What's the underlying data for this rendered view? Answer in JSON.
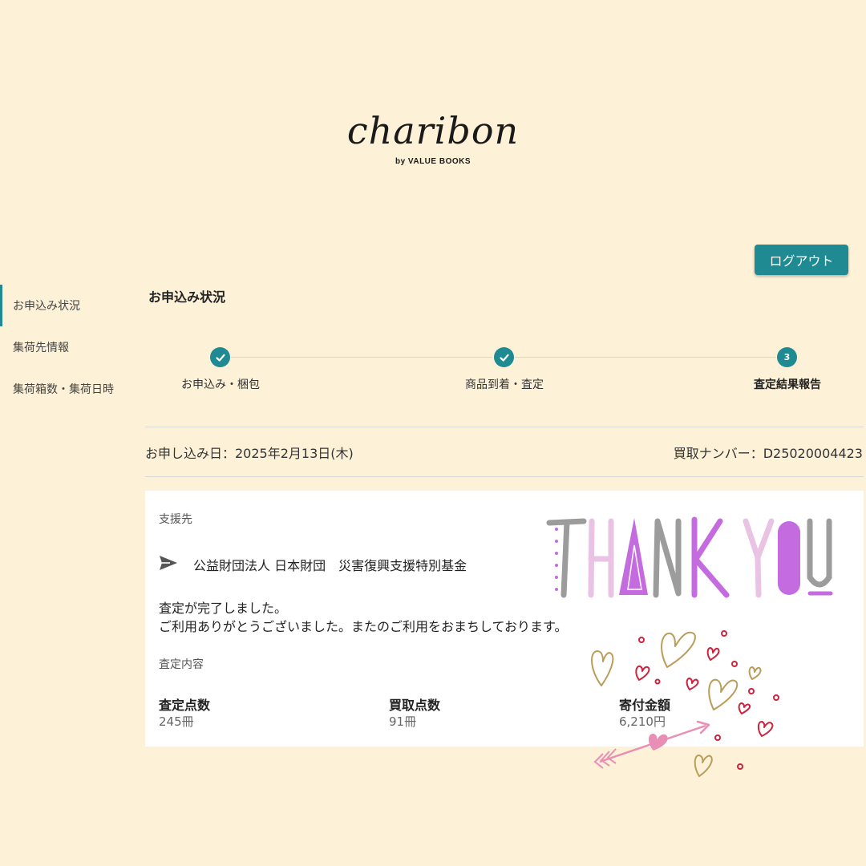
{
  "brand": {
    "logo_text": "charibon",
    "logo_sub": "by VALUE BOOKS"
  },
  "header": {
    "logout_label": "ログアウト"
  },
  "sidebar": {
    "items": [
      {
        "label": "お申込み状況",
        "active": true
      },
      {
        "label": "集荷先情報",
        "active": false
      },
      {
        "label": "集荷箱数・集荷日時",
        "active": false
      }
    ]
  },
  "main": {
    "title": "お申込み状況",
    "steps": [
      {
        "number": "1",
        "label": "お申込み・梱包",
        "status": "done"
      },
      {
        "number": "2",
        "label": "商品到着・査定",
        "status": "done"
      },
      {
        "number": "3",
        "label": "査定結果報告",
        "status": "current"
      }
    ],
    "apply_date": "お申し込み日：2025年2月13日(木)",
    "buy_number": "買取ナンバー：D25020004423"
  },
  "card": {
    "support_label": "支援先",
    "support_org": "公益財団法人 日本財団　災害復興支援特別基金",
    "message_line1": "査定が完了しました。",
    "message_line2": "ご利用ありがとうございました。またのご利用をおまちしております。",
    "detail_label": "査定内容",
    "stats": [
      {
        "title": "査定点数",
        "value": "245冊"
      },
      {
        "title": "買取点数",
        "value": "91冊"
      },
      {
        "title": "寄付金額",
        "value": "6,210円"
      }
    ]
  },
  "overlay": {
    "text": "THANK YOU"
  },
  "colors": {
    "background": "#fdf2d8",
    "accent": "#1f8a91",
    "purple": "#c46be0",
    "pink": "#e98fb5",
    "red": "#d0213d",
    "gold": "#b99d5a"
  },
  "icons": [
    "check-icon",
    "send-icon",
    "heart-icon",
    "arrow-icon"
  ]
}
